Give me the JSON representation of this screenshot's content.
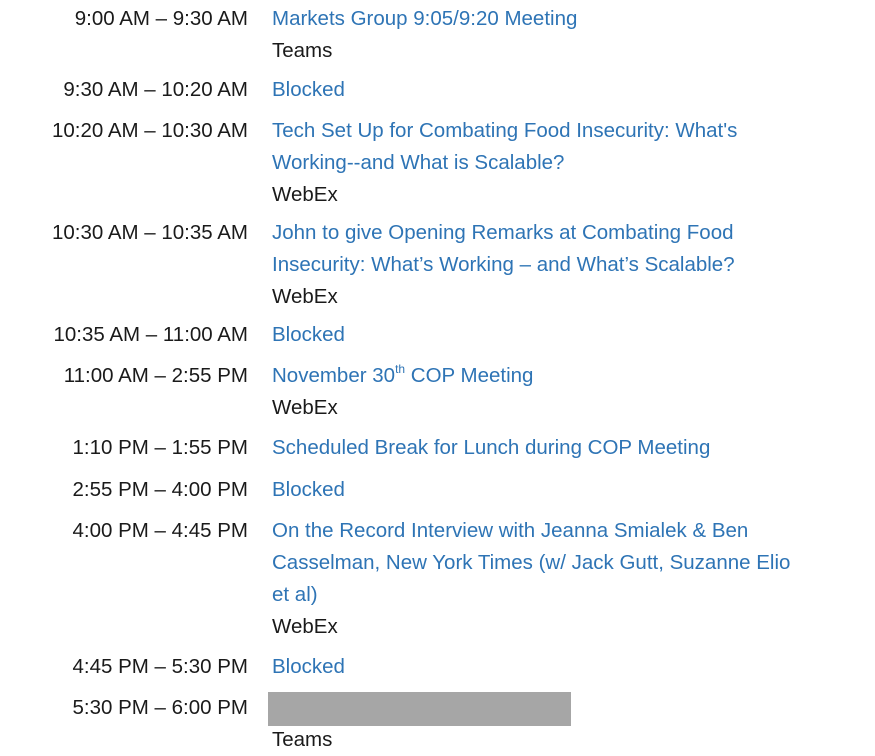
{
  "events": [
    {
      "time": "9:00 AM – 9:30 AM",
      "title_lines": [
        "Markets Group 9:05/9:20 Meeting"
      ],
      "location": "Teams"
    },
    {
      "time": "9:30 AM – 10:20 AM",
      "title_lines": [
        "Blocked"
      ]
    },
    {
      "time": "10:20 AM – 10:30 AM",
      "title_lines": [
        "Tech Set Up for Combating Food Insecurity: What's",
        "Working--and What is Scalable?"
      ],
      "location": "WebEx"
    },
    {
      "time": "10:30 AM – 10:35 AM",
      "title_lines": [
        "John to give Opening Remarks at Combating Food",
        "Insecurity: What’s Working – and What’s Scalable?"
      ],
      "location": "WebEx"
    },
    {
      "time": "10:35 AM – 11:00 AM",
      "title_lines": [
        "Blocked"
      ]
    },
    {
      "time": "11:00 AM – 2:55 PM",
      "title_pre": "November 30",
      "title_sup": "th",
      "title_post": " COP Meeting",
      "location": "WebEx"
    },
    {
      "time": "1:10 PM – 1:55 PM",
      "title_lines": [
        "Scheduled Break for Lunch during COP Meeting"
      ]
    },
    {
      "time": "2:55 PM – 4:00 PM",
      "title_lines": [
        "Blocked"
      ]
    },
    {
      "time": "4:00 PM – 4:45 PM",
      "title_lines": [
        "On the Record Interview with Jeanna Smialek & Ben",
        "Casselman, New York Times (w/ Jack Gutt, Suzanne Elio",
        "et al)"
      ],
      "location": "WebEx"
    },
    {
      "time": "4:45 PM – 5:30 PM",
      "title_lines": [
        "Blocked"
      ]
    },
    {
      "time": "5:30 PM – 6:00 PM",
      "redacted": true,
      "location": "Teams"
    }
  ]
}
